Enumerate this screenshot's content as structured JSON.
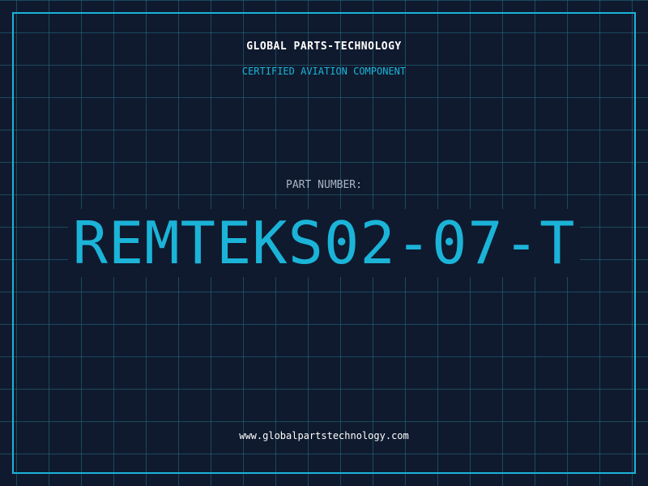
{
  "header": {
    "brand": "GLOBAL PARTS-TECHNOLOGY",
    "subtitle": "CERTIFIED AVIATION COMPONENT"
  },
  "part": {
    "label": "PART NUMBER:",
    "number": "REMTEKS02-07-T"
  },
  "footer": {
    "website": "www.globalpartstechnology.com"
  },
  "colors": {
    "background": "#0f1a2e",
    "accent": "#1bb4d8",
    "grid": "#266e82",
    "text": "#ffffff",
    "muted": "#a9b6c6"
  }
}
